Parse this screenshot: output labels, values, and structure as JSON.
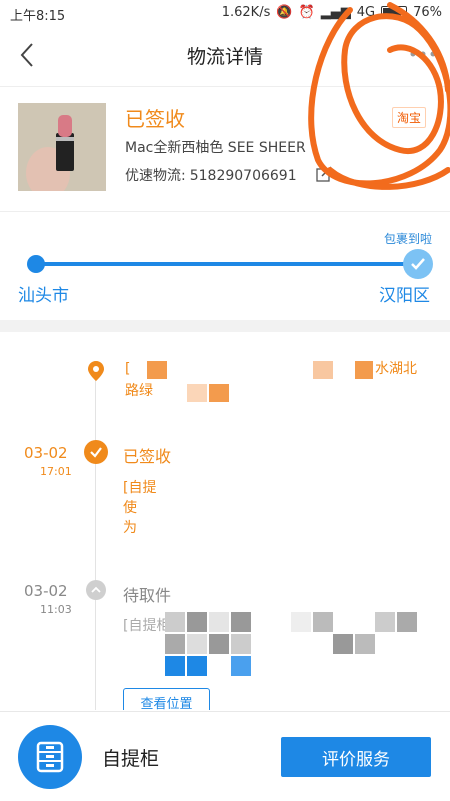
{
  "status_bar": {
    "time": "上午8:15",
    "network_speed": "1.62K/s",
    "network_type": "4G",
    "battery_percent": "76%",
    "battery_level": 0.76
  },
  "header": {
    "title": "物流详情"
  },
  "product": {
    "status": "已签收",
    "name": "Mac全新西柚色 SEE SHEER",
    "tracking_label": "优速物流:",
    "tracking_number": "518290706691",
    "platform_badge": "淘宝"
  },
  "route": {
    "note": "包裹到啦",
    "from": "汕头市",
    "to": "汉阳区"
  },
  "timeline": {
    "address_line1_start": "[",
    "address_line1_end": "水湖北",
    "address_line2": "路绿",
    "events": [
      {
        "date": "03-02",
        "time": "17:01",
        "title": "已签收",
        "desc_lines": [
          "[自提",
          "使",
          "为"
        ],
        "color": "#f08a1b"
      },
      {
        "date": "03-02",
        "time": "11:03",
        "title": "待取件",
        "desc_lines": [
          "[自提柜]",
          ""
        ],
        "color": "#888888"
      }
    ],
    "view_location_label": "查看位置"
  },
  "bottom_bar": {
    "locker_label": "自提柜",
    "rate_button_label": "评价服务"
  },
  "colors": {
    "accent_blue": "#1e88e5",
    "accent_orange": "#f08a1b",
    "annotation_orange": "#f26b1d"
  },
  "icons": [
    "back-icon",
    "more-icon",
    "edit-icon",
    "location-pin-icon",
    "checkmark-icon",
    "chevron-up-icon",
    "locker-icon"
  ]
}
